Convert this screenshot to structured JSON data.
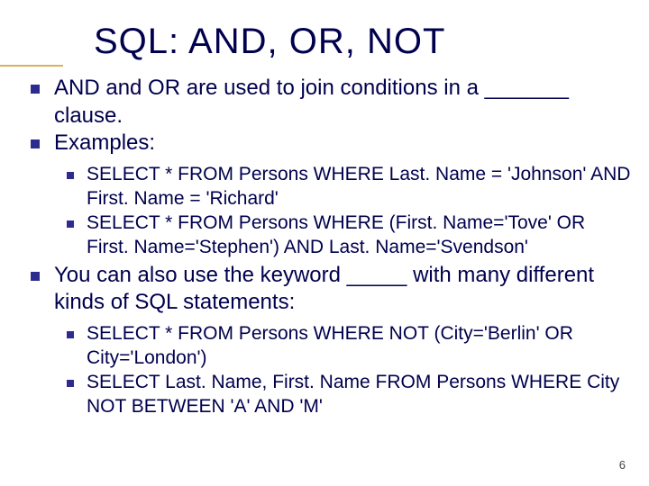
{
  "title": "SQL: AND, OR, NOT",
  "page_number": "6",
  "bullets": [
    {
      "text": "AND and OR are used to join conditions in a _______ clause."
    },
    {
      "text": "Examples:",
      "children": [
        {
          "text": "SELECT * FROM Persons WHERE Last. Name = 'Johnson' AND First. Name = 'Richard'"
        },
        {
          "text": "SELECT * FROM Persons WHERE (First. Name='Tove' OR First. Name='Stephen') AND Last. Name='Svendson'"
        }
      ]
    },
    {
      "text": "You can also use the keyword _____ with many different kinds of SQL statements:",
      "children": [
        {
          "text": "SELECT * FROM Persons WHERE NOT (City='Berlin' OR City='London')"
        },
        {
          "text": "SELECT Last. Name, First. Name FROM Persons WHERE City NOT BETWEEN 'A' AND 'M'"
        }
      ]
    }
  ]
}
